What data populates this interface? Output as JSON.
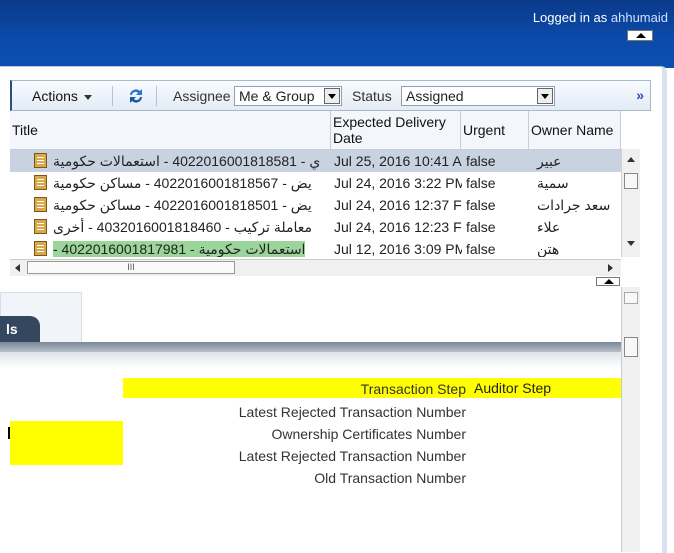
{
  "header": {
    "logged_prefix": "Logged in as ",
    "username": "ahhumaid"
  },
  "toolbar": {
    "actions_label": "Actions",
    "assignee_label": "Assignee",
    "assignee_value": "Me & Group",
    "status_label": "Status",
    "status_value": "Assigned",
    "more_label": "»"
  },
  "table": {
    "columns": {
      "title": "Title",
      "date_line1": "Expected Delivery",
      "date_line2": "Date",
      "urgent": "Urgent",
      "owner": "Owner Name"
    },
    "rows": [
      {
        "title": "ي - 4022016001818581 - استعمالات حكومية",
        "date": "Jul 25, 2016 10:41 A",
        "urgent": "false",
        "owner": "عبير",
        "selected": true
      },
      {
        "title": "يض - 4022016001818567 - مساكن حكومية",
        "date": "Jul 24, 2016 3:22 PM",
        "urgent": "false",
        "owner": "سمية",
        "selected": false
      },
      {
        "title": "يض - 4022016001818501 - مساكن حكومية",
        "date": "Jul 24, 2016 12:37 F",
        "urgent": "false",
        "owner": "سعد جرادات",
        "selected": false
      },
      {
        "title": "معاملة تركيب - 4032016001818460 - أخرى",
        "date": "Jul 24, 2016 12:23 F",
        "urgent": "false",
        "owner": "علاء",
        "selected": false
      },
      {
        "title": "- 4022016001817981 - استعمالات حكومية",
        "date": "Jul 12, 2016 3:09 PM",
        "urgent": "false",
        "owner": "هتن",
        "selected": false
      }
    ],
    "hscroll_grip": "III"
  },
  "tab": {
    "label": "ls"
  },
  "details": {
    "transaction_step_label": "Transaction Step",
    "transaction_step_value": "Auditor Step",
    "latest_rejected_label": "Latest Rejected Transaction Number",
    "ownership_label": "Ownership Certificates Number",
    "latest_rejected_label_2": "Latest Rejected Transaction Number",
    "old_transaction_label": "Old Transaction Number"
  },
  "colors": {
    "header_blue": "#0b4aa8",
    "highlight_yellow": "#ffff00",
    "selected_row": "#c8d2e0",
    "green_highlight": "#9bd59b"
  }
}
